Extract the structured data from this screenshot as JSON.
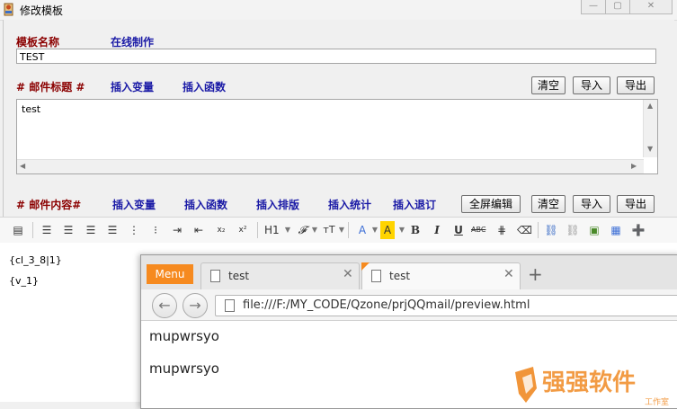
{
  "window": {
    "title": "修改模板",
    "minimize": "—",
    "maximize": "▢",
    "close": "✕"
  },
  "template_name": {
    "label": "模板名称",
    "online_link": "在线制作",
    "value": "TEST"
  },
  "subject": {
    "label": "# 邮件标题 #",
    "insert_variable": "插入变量",
    "insert_function": "插入函数",
    "clear": "清空",
    "import": "导入",
    "export": "导出",
    "value": "test"
  },
  "content": {
    "label": "# 邮件内容#",
    "insert_variable": "插入变量",
    "insert_function": "插入函数",
    "insert_layout": "插入排版",
    "insert_stats": "插入统计",
    "insert_unsubscribe": "插入退订",
    "fullscreen": "全屏编辑",
    "clear": "清空",
    "import": "导入",
    "export": "导出"
  },
  "toolbar": {
    "heading": "H1",
    "font": "𝓕",
    "size": "тT",
    "font_color": "A",
    "highlight": "A",
    "bold": "B",
    "italic": "I",
    "underline": "U",
    "strike": "ABC",
    "subscript": "x₂",
    "superscript": "x²"
  },
  "editor": {
    "lines": [
      "{cl_3_8|1}",
      "{v_1}"
    ]
  },
  "browser": {
    "menu": "Menu",
    "tabs": [
      {
        "title": "test"
      },
      {
        "title": "test"
      }
    ],
    "new_tab": "+",
    "url": "file:///F:/MY_CODE/Qzone/prjQQmail/preview.html",
    "page_lines": [
      "mupwrsyo",
      "mupwrsyo"
    ]
  },
  "watermark": {
    "text": "强强软件",
    "sub": "工作室"
  },
  "colors": {
    "label_red": "#8b0000",
    "link_blue": "#1a1aa6",
    "menu_orange": "#f68a1f"
  }
}
